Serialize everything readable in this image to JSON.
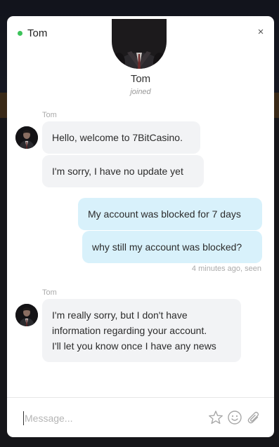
{
  "colors": {
    "online": "#3cc35a",
    "agent_bubble": "#f2f3f5",
    "user_bubble": "#d8f1fb"
  },
  "header": {
    "name": "Tom",
    "status": "online",
    "close_label": "×"
  },
  "agent_card": {
    "name": "Tom",
    "status_text": "joined"
  },
  "messages": {
    "group1": {
      "sender": "Tom",
      "items": [
        "Hello, welcome to 7BitCasino.",
        "I'm sorry, I have no update yet"
      ]
    },
    "user": {
      "items": [
        "My account was blocked for 7 days",
        "why still my account was blocked?"
      ],
      "meta": "4 minutes ago, seen"
    },
    "group2": {
      "sender": "Tom",
      "lines": [
        "I'm really sorry, but I don't have",
        "information regarding your account.",
        "I'll let you know once I have any news"
      ]
    }
  },
  "composer": {
    "placeholder": "Message...",
    "icons": [
      "star-icon",
      "emoji-icon",
      "attachment-icon"
    ]
  }
}
